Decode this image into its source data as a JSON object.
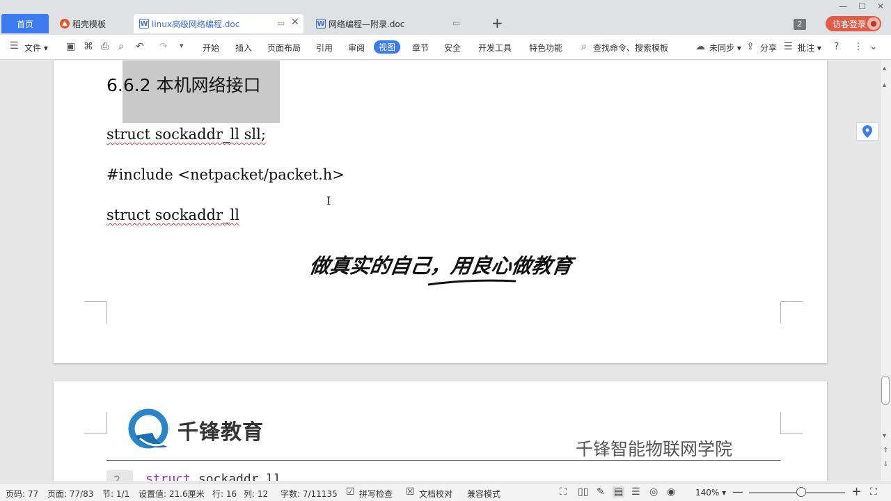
{
  "tabs": {
    "home": "首页",
    "template": "稻壳模板",
    "doc1": "linux高级网络编程.doc",
    "doc2": "网络编程—附录.doc"
  },
  "tab_count": "2",
  "login_label": "访客登录",
  "toolbar": {
    "file": "文件",
    "menus": [
      "开始",
      "插入",
      "页面布局",
      "引用",
      "审阅",
      "视图",
      "章节",
      "安全",
      "开发工具",
      "特色功能"
    ],
    "search": "查找命令、搜索模板",
    "sync": "未同步",
    "share": "分享",
    "comment": "批注"
  },
  "document": {
    "heading": "6.6.2 本机网络接口",
    "code_lines": [
      "struct sockaddr_ll sll;",
      "#include <netpacket/packet.h>",
      "struct sockaddr_ll"
    ],
    "slogan": "做真实的自己，用良心做教育",
    "logo_text": "千锋教育",
    "institute": "千锋智能物联网学院",
    "code2_line_number": "2",
    "code2_keyword": "struct",
    "code2_rest": " sockaddr_ll"
  },
  "status": {
    "page_code": "页码: 77",
    "page": "页面: 77/83",
    "section": "节: 1/1",
    "setting": "设置值: 21.6厘米",
    "row": "行: 16",
    "col": "列: 12",
    "words": "字数: 7/11135",
    "spell": "拼写检查",
    "proof": "文档校对",
    "compat": "兼容模式",
    "zoom": "140%"
  },
  "colors": {
    "accent": "#3d7cf0",
    "login": "#e25c4a",
    "keyword": "#9b30b8"
  }
}
